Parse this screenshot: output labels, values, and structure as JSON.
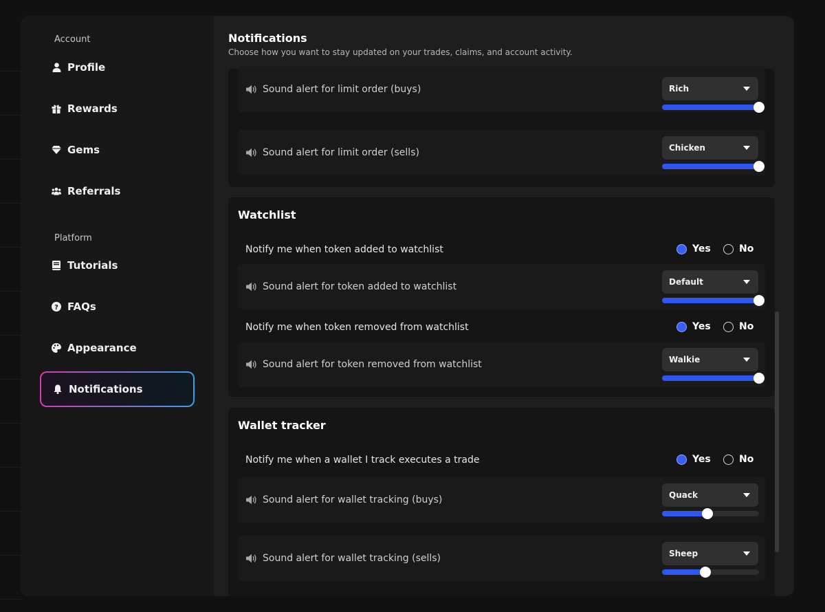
{
  "sidebar": {
    "account_heading": "Account",
    "platform_heading": "Platform",
    "items": [
      {
        "label": "Profile",
        "icon": "user-icon"
      },
      {
        "label": "Rewards",
        "icon": "gift-icon"
      },
      {
        "label": "Gems",
        "icon": "gem-icon"
      },
      {
        "label": "Referrals",
        "icon": "users-icon"
      },
      {
        "label": "Tutorials",
        "icon": "book-icon"
      },
      {
        "label": "FAQs",
        "icon": "help-icon"
      },
      {
        "label": "Appearance",
        "icon": "palette-icon"
      },
      {
        "label": "Notifications",
        "icon": "bell-icon",
        "active": true
      }
    ]
  },
  "page": {
    "title": "Notifications",
    "subtitle": "Choose how you want to stay updated on your trades, claims, and account activity."
  },
  "limit_orders": {
    "rows": [
      {
        "label": "Sound alert for limit order (buys)",
        "sound": "Rich",
        "volume_pct": 100
      },
      {
        "label": "Sound alert for limit order (sells)",
        "sound": "Chicken",
        "volume_pct": 100
      }
    ]
  },
  "watchlist": {
    "title": "Watchlist",
    "notify_added": {
      "label": "Notify me when token added to watchlist",
      "value": "Yes"
    },
    "sound_added": {
      "label": "Sound alert for token added to watchlist",
      "sound": "Default",
      "volume_pct": 100
    },
    "notify_removed": {
      "label": "Notify me when token removed from watchlist",
      "value": "Yes"
    },
    "sound_removed": {
      "label": "Sound alert for token removed from watchlist",
      "sound": "Walkie",
      "volume_pct": 100
    }
  },
  "wallet_tracker": {
    "title": "Wallet tracker",
    "notify_trade": {
      "label": "Notify me when a wallet I track executes a trade",
      "value": "Yes"
    },
    "sound_buys": {
      "label": "Sound alert for wallet tracking (buys)",
      "sound": "Quack",
      "volume_pct": 47
    },
    "sound_sells": {
      "label": "Sound alert for wallet tracking (sells)",
      "sound": "Sheep",
      "volume_pct": 45
    }
  },
  "radio_labels": {
    "yes": "Yes",
    "no": "No"
  },
  "colors": {
    "accent": "#2f56f0",
    "active_border_start": "#d63ab8",
    "active_border_end": "#3aa0e6"
  }
}
